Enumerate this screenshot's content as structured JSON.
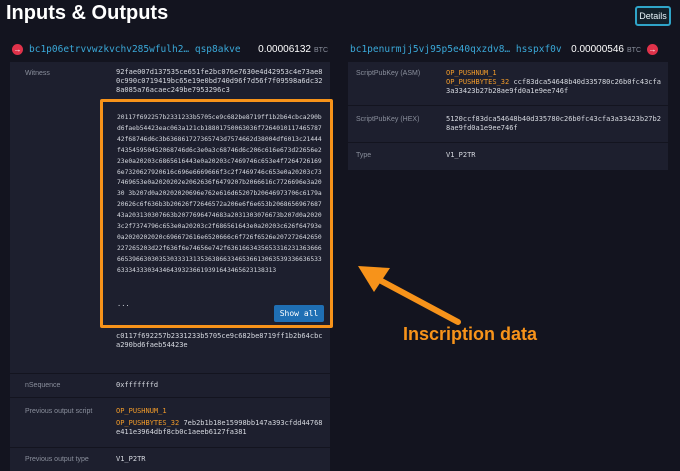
{
  "page": {
    "title": "Inputs & Outputs",
    "details_label": "Details"
  },
  "input": {
    "address": "bc1p06etrvvwzkvchv285wfulh2… qsp8akve",
    "amount": "0.00006132",
    "unit": "BTC",
    "witness_label": "Witness",
    "witness_value": "92fae007d137535ce651fe2bc076e7630e4d42953c4e73ae80c990c0719419bc65e19e0bd740d96f7d56f7f09598a6dc328a085a76acaec249be7953296c3",
    "inscription_text": "20117f692257b2331233b5705ce9c682be8719ff1b2b64cbca290bd6faeb54423eac063a121cb18801750063036f726401011746578742f68746d6c3b636861727365743d7574662d38004df6013c21444f43545950452068746d6c3e0a3c68746d6c206c616e673d22656e223e0a20203c6865616443e0a20203c7469746c653e4f72647261696e7320627920616c696e6669666f3c2f7469746c653e0a20203c737469653e0a2020202e2062636f6479207b2066616c7726696e3a2030 3b207d0a20202020696e762e616d65207b20646973706c6179a20626c6f636b3b20626f72646572a206e6f6e653b206865696768743a203130307663b2077696474683a2031303076673b207d0a20203c2f7374796c653e0a20203c2f686561643e0a20203c626f64793e0a2020202020c696672616e6520666c6f726f6526e207272642650227265203d22f636f6e74656e742f6361663435653316231363666665396630303530333131353638663346536613063539336636533633343330343464393236619391643465623138313",
    "ellipsis": "...",
    "show_all_label": "Show all",
    "after_text": "c0117f692257b2331233b5705ce9c682be8719ff1b2b64cbca290bd6faeb54423e",
    "sequence_label": "nSequence",
    "sequence_value": "0xfffffffd",
    "prev_script_label": "Previous output script",
    "prev_script_op1": "OP_PUSHNUM_1",
    "prev_script_op2": "OP_PUSHBYTES_32",
    "prev_script_value": "7eb2b1b18e15998bb147a393cfdd44768e411e3964dbf8cb0c1aeeb6127fa381",
    "prev_type_label": "Previous output type",
    "prev_type_value": "V1_P2TR"
  },
  "output": {
    "address": "bc1penurmjj5vj95p5e40qxzdv8… hsspxf0v",
    "amount": "0.00000546",
    "unit": "BTC",
    "asm_label": "ScriptPubKey (ASM)",
    "asm_op1": "OP_PUSHNUM_1",
    "asm_op2": "OP_PUSHBYTES_32",
    "asm_value": "ccf83dca54648b40d335780c26b0fc43cfa3a33423b27b28ae9fd0a1e9ee746f",
    "hex_label": "ScriptPubKey (HEX)",
    "hex_value": "5120ccf83dca54648b40d335780c26b0fc43cfa3a33423b27b28ae9fd0a1e9ee746f",
    "type_label": "Type",
    "type_value": "V1_P2TR"
  },
  "annotation": {
    "callout": "Inscription data",
    "color": "#f7931a"
  }
}
